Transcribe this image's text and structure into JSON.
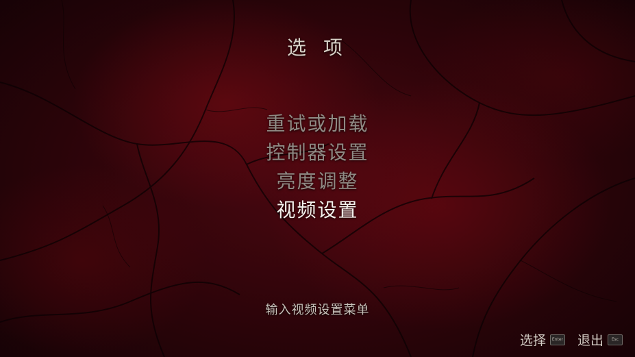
{
  "title": "选 项",
  "menu": {
    "items": [
      {
        "label": "重试或加载",
        "selected": false
      },
      {
        "label": "控制器设置",
        "selected": false
      },
      {
        "label": "亮度调整",
        "selected": false
      },
      {
        "label": "视频设置",
        "selected": true
      }
    ]
  },
  "description": "输入视频设置菜单",
  "footer": {
    "select_label": "选择",
    "select_key": "Enter",
    "exit_label": "退出",
    "exit_key": "Esc"
  },
  "colors": {
    "background": "#2a0409",
    "menu_normal": "#8f8a84",
    "menu_selected": "#f4f1ec"
  }
}
